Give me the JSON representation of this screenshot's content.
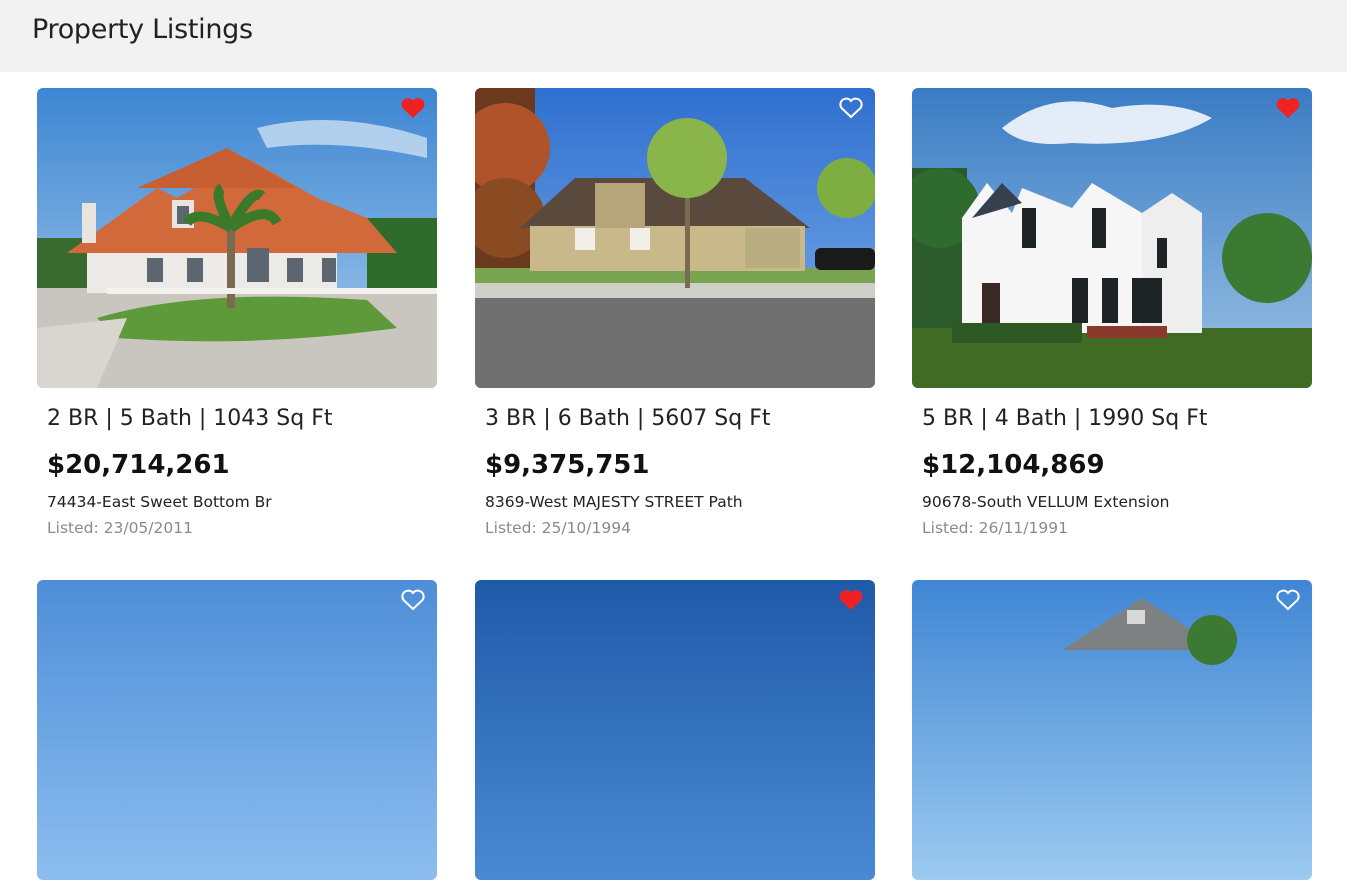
{
  "page": {
    "title": "Property Listings"
  },
  "colors": {
    "header_bg": "#f2f2f2",
    "favorite": "#ee2222",
    "listed_text": "#8a8a8a"
  },
  "listings": [
    {
      "spec": "2 BR | 5 Bath | 1043 Sq Ft",
      "price": "$20,714,261",
      "address": "74434-East Sweet Bottom Br",
      "listed": "Listed: 23/05/2011",
      "favorited": true,
      "photo": "white-house-orange-roof"
    },
    {
      "spec": "3 BR | 6 Bath | 5607 Sq Ft",
      "price": "$9,375,751",
      "address": "8369-West MAJESTY STREET Path",
      "listed": "Listed: 25/10/1994",
      "favorited": false,
      "photo": "tan-suburban-house"
    },
    {
      "spec": "5 BR | 4 Bath | 1990 Sq Ft",
      "price": "$12,104,869",
      "address": "90678-South VELLUM Extension",
      "listed": "Listed: 26/11/1991",
      "favorited": true,
      "photo": "modern-white-house"
    },
    {
      "favorited": false,
      "photo": "blue-sky"
    },
    {
      "favorited": true,
      "photo": "deep-blue-sky"
    },
    {
      "favorited": false,
      "photo": "grey-roof-house"
    }
  ]
}
